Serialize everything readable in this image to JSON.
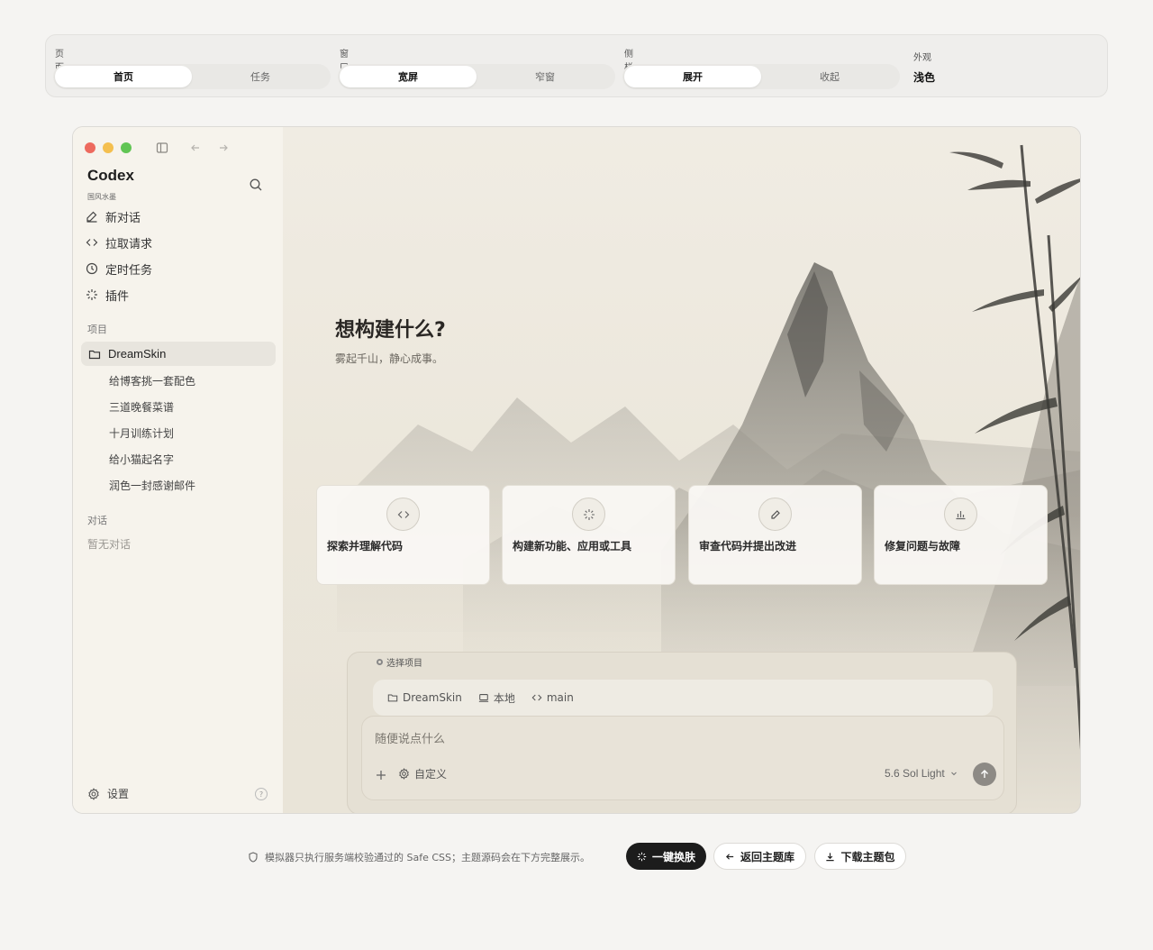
{
  "controls": {
    "page": {
      "label": "页面",
      "options": [
        "首页",
        "任务"
      ],
      "selected": "首页"
    },
    "window": {
      "label": "窗口",
      "options": [
        "宽屏",
        "窄窗"
      ],
      "selected": "宽屏"
    },
    "sidebar": {
      "label": "侧栏",
      "options": [
        "展开",
        "收起"
      ],
      "selected": "展开"
    },
    "appearance": {
      "label": "外观",
      "value": "浅色"
    }
  },
  "app": {
    "name": "Codex",
    "theme_name": "国风水墨",
    "nav": [
      {
        "label": "新对话",
        "icon": "edit-icon"
      },
      {
        "label": "拉取请求",
        "icon": "code-icon"
      },
      {
        "label": "定时任务",
        "icon": "clock-icon"
      },
      {
        "label": "插件",
        "icon": "sparkle-icon"
      }
    ],
    "projects_label": "项目",
    "project": "DreamSkin",
    "threads": [
      "给博客挑一套配色",
      "三道晚餐菜谱",
      "十月训练计划",
      "给小猫起名字",
      "润色一封感谢邮件"
    ],
    "conversations_label": "对话",
    "conversations_empty": "暂无对话",
    "settings_label": "设置",
    "help_label": "?"
  },
  "main": {
    "title": "想构建什么?",
    "subtitle": "雾起千山，静心成事。",
    "cards": [
      {
        "label": "探索并理解代码",
        "icon": "code-icon"
      },
      {
        "label": "构建新功能、应用或工具",
        "icon": "sparkle-icon"
      },
      {
        "label": "审查代码并提出改进",
        "icon": "pen-icon"
      },
      {
        "label": "修复问题与故障",
        "icon": "chart-icon"
      }
    ],
    "composer": {
      "select_project": "选择项目",
      "project": "DreamSkin",
      "location": "本地",
      "branch": "main",
      "placeholder": "随便说点什么",
      "custom": "自定义",
      "model": "5.6 Sol Light"
    }
  },
  "footer": {
    "note": "模拟器只执行服务端校验通过的 Safe CSS；主题源码会在下方完整展示。",
    "apply": "一键换肤",
    "back": "返回主题库",
    "download": "下载主题包"
  }
}
